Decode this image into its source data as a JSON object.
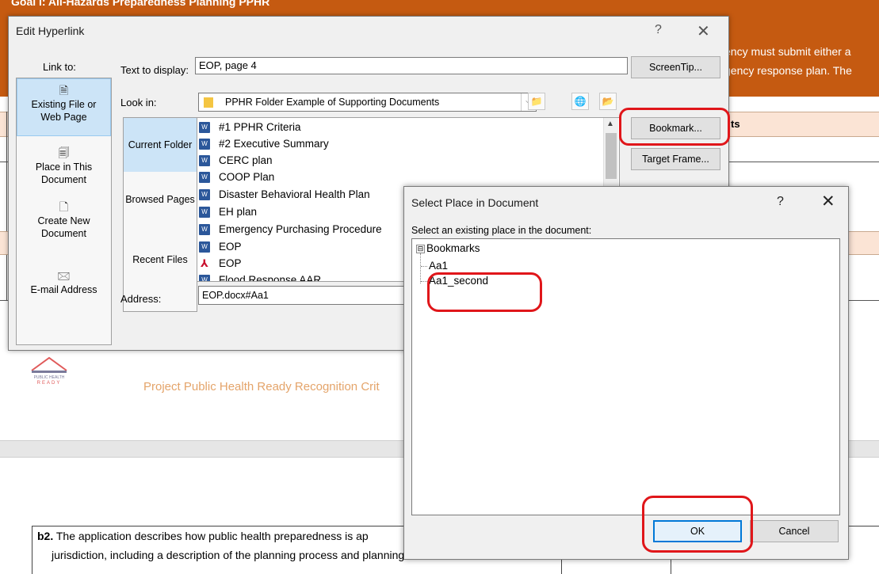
{
  "document": {
    "header_goal": "Goal I: All-Hazards Preparedness Planning PPHR",
    "header_line1": "ency must submit either a",
    "header_line2": "gency response plan. The",
    "column_fragment": "ts",
    "footer_text": "Project Public Health Ready Recognition Crit",
    "logo_text": "PUBLIC HEALTH READY",
    "b2_label": "b2.",
    "b2_line1": "The application describes how public health preparedness is ap",
    "b2_line2": "jurisdiction, including a description of the planning process and planning team"
  },
  "edit_hyperlink": {
    "title": "Edit Hyperlink",
    "help": "?",
    "close": "✕",
    "link_to_label": "Link to:",
    "link_to_items": [
      {
        "label1": "Existing File or",
        "label2": "Web Page",
        "icon": "file-globe-icon"
      },
      {
        "label1": "Place in This",
        "label2": "Document",
        "icon": "document-place-icon"
      },
      {
        "label1": "Create New",
        "label2": "Document",
        "icon": "new-document-icon"
      },
      {
        "label1": "E-mail Address",
        "label2": "",
        "icon": "email-icon"
      }
    ],
    "text_to_display_label": "Text to display:",
    "text_to_display_value": "EOP, page 4",
    "screentip_button": "ScreenTip...",
    "look_in_label": "Look in:",
    "look_in_value": "PPHR Folder Example of Supporting Documents",
    "bookmark_button": "Bookmark...",
    "target_frame_button": "Target Frame...",
    "nav_items": [
      "Current Folder",
      "Browsed Pages",
      "Recent Files"
    ],
    "files": [
      {
        "name": "#1 PPHR Criteria",
        "type": "word"
      },
      {
        "name": "#2 Executive Summary",
        "type": "word"
      },
      {
        "name": "CERC plan",
        "type": "word"
      },
      {
        "name": "COOP Plan",
        "type": "word"
      },
      {
        "name": "Disaster Behavioral Health Plan",
        "type": "word"
      },
      {
        "name": "EH plan",
        "type": "word"
      },
      {
        "name": "Emergency Purchasing Procedure",
        "type": "word"
      },
      {
        "name": "EOP",
        "type": "word"
      },
      {
        "name": "EOP",
        "type": "pdf"
      },
      {
        "name": "Flood Response AAR",
        "type": "word"
      }
    ],
    "address_label": "Address:",
    "address_value": "EOP.docx#Aa1"
  },
  "select_place": {
    "title": "Select Place in Document",
    "help": "?",
    "close": "✕",
    "instruction": "Select an existing place in the document:",
    "root": "Bookmarks",
    "root_toggle": "⊟",
    "children": [
      "Aa1",
      "Aa1_second"
    ],
    "ok_button": "OK",
    "cancel_button": "Cancel"
  },
  "colors": {
    "header_orange": "#c55a11",
    "selection_blue": "#cce4f7",
    "annotation_red": "#e0161a",
    "default_button_border": "#0078d7"
  }
}
